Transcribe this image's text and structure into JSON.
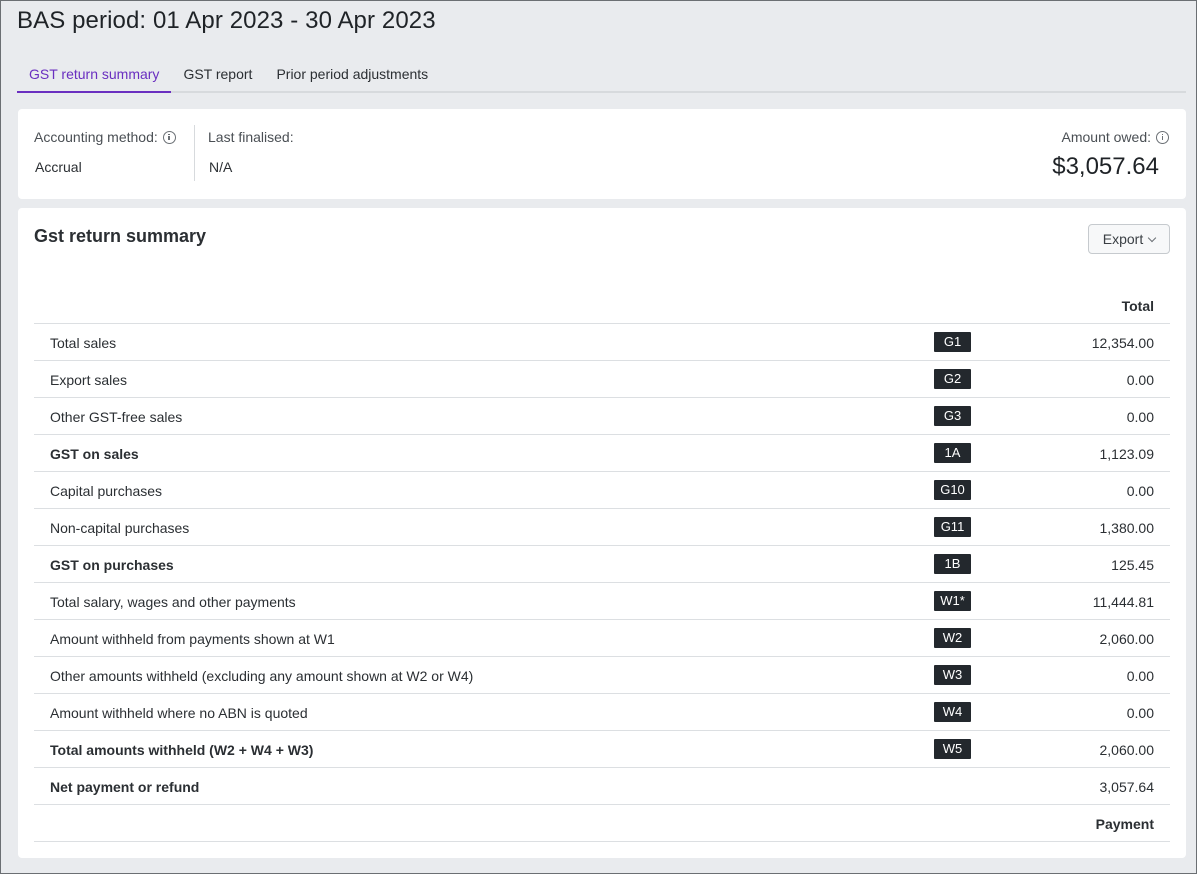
{
  "header": {
    "title": "BAS period: 01 Apr 2023 - 30 Apr 2023"
  },
  "tabs": [
    {
      "label": "GST return summary",
      "active": true
    },
    {
      "label": "GST report",
      "active": false
    },
    {
      "label": "Prior period adjustments",
      "active": false
    }
  ],
  "info": {
    "accounting_method_label": "Accounting method:",
    "accounting_method_value": "Accrual",
    "last_finalised_label": "Last finalised:",
    "last_finalised_value": "N/A",
    "amount_owed_label": "Amount owed:",
    "amount_owed_value": "$3,057.64"
  },
  "summary": {
    "title": "Gst return summary",
    "export_label": "Export",
    "column_total": "Total",
    "footer_label": "Payment",
    "rows": [
      {
        "label": "Total sales",
        "code": "G1",
        "value": "12,354.00",
        "bold": false
      },
      {
        "label": "Export sales",
        "code": "G2",
        "value": "0.00",
        "bold": false
      },
      {
        "label": "Other GST-free sales",
        "code": "G3",
        "value": "0.00",
        "bold": false
      },
      {
        "label": "GST on sales",
        "code": "1A",
        "value": "1,123.09",
        "bold": true
      },
      {
        "label": "Capital purchases",
        "code": "G10",
        "value": "0.00",
        "bold": false
      },
      {
        "label": "Non-capital purchases",
        "code": "G11",
        "value": "1,380.00",
        "bold": false
      },
      {
        "label": "GST on purchases",
        "code": "1B",
        "value": "125.45",
        "bold": true
      },
      {
        "label": "Total salary, wages and other payments",
        "code": "W1*",
        "value": "11,444.81",
        "bold": false
      },
      {
        "label": "Amount withheld from payments shown at W1",
        "code": "W2",
        "value": "2,060.00",
        "bold": false
      },
      {
        "label": "Other amounts withheld (excluding any amount shown at W2 or W4)",
        "code": "W3",
        "value": "0.00",
        "bold": false
      },
      {
        "label": "Amount withheld where no ABN is quoted",
        "code": "W4",
        "value": "0.00",
        "bold": false
      },
      {
        "label": "Total amounts withheld (W2 + W4 + W3)",
        "code": "W5",
        "value": "2,060.00",
        "bold": true
      },
      {
        "label": "Net payment or refund",
        "code": "",
        "value": "3,057.64",
        "bold": true
      }
    ]
  },
  "colors": {
    "accent": "#6a2fc0",
    "code_badge": "#23282d",
    "page_bg": "#e9ebee"
  }
}
